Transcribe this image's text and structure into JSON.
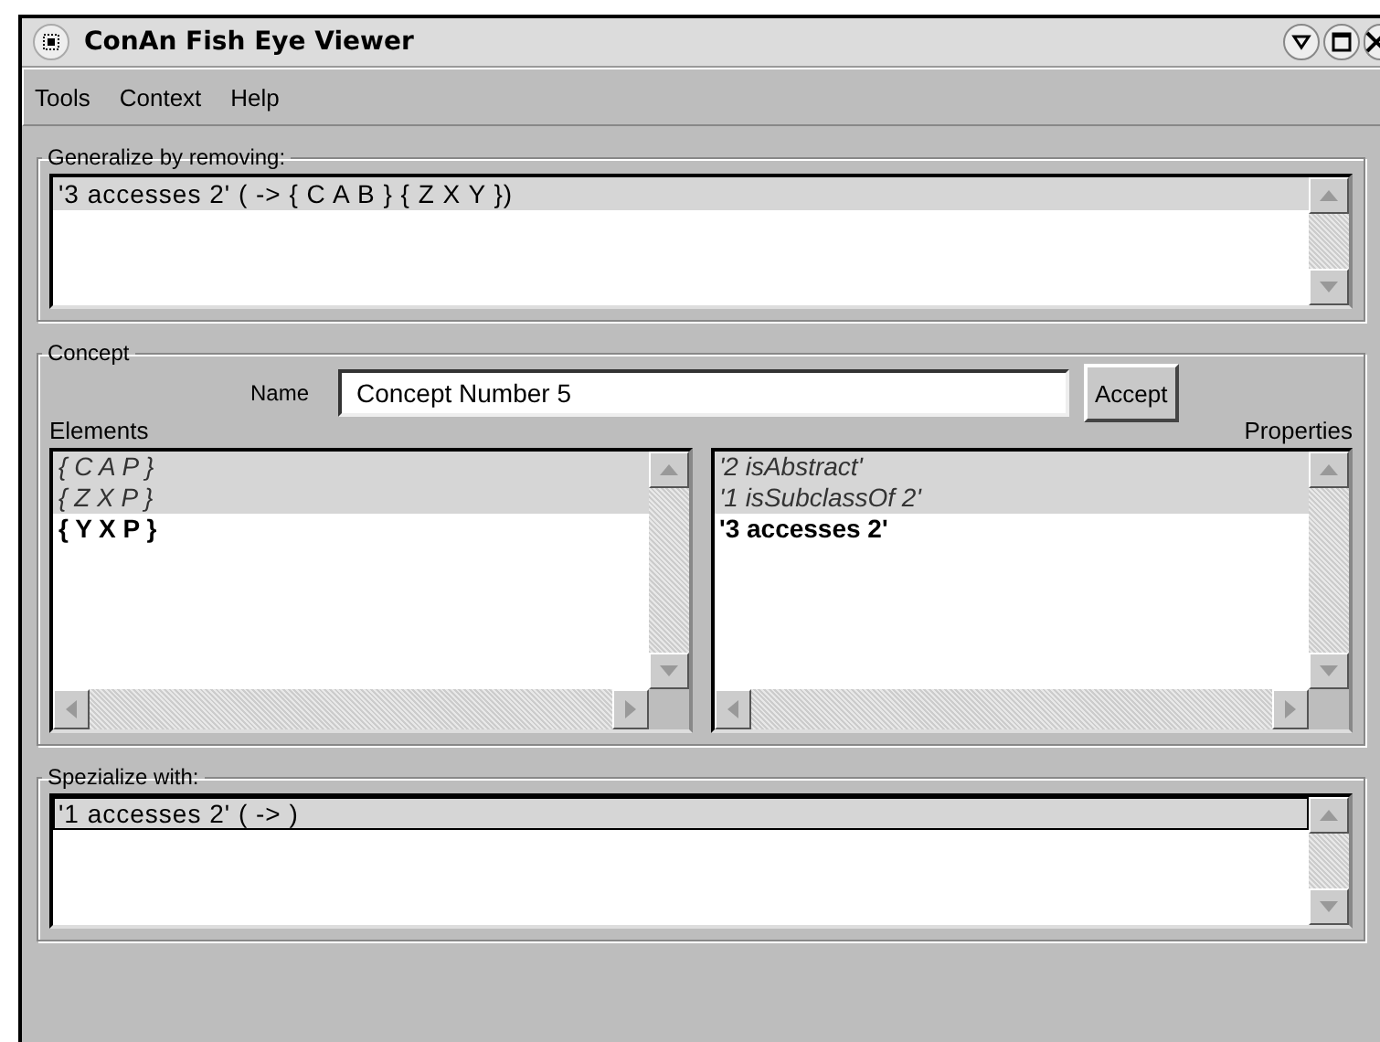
{
  "window": {
    "title": "ConAn Fish Eye Viewer"
  },
  "menu": [
    "Tools",
    "Context",
    "Help"
  ],
  "generalize": {
    "label": "Generalize by removing:",
    "items": [
      {
        "text": "'3 accesses 2' ( -> { C A B } { Z X Y })",
        "selected": true
      }
    ]
  },
  "concept": {
    "label": "Concept",
    "name_label": "Name",
    "name_value": "Concept Number 5",
    "accept": "Accept",
    "elements_label": "Elements",
    "properties_label": "Properties",
    "elements": [
      {
        "text": "{ C A P }",
        "kind": "italic",
        "selected": true
      },
      {
        "text": "{ Z X P }",
        "kind": "italic",
        "selected": true
      },
      {
        "text": "{ Y X P }",
        "kind": "bold",
        "selected": false
      }
    ],
    "properties": [
      {
        "text": "'2 isAbstract'",
        "kind": "italic",
        "selected": true
      },
      {
        "text": "'1 isSubclassOf 2'",
        "kind": "italic",
        "selected": true
      },
      {
        "text": "'3 accesses 2'",
        "kind": "bold",
        "selected": false
      }
    ]
  },
  "specialize": {
    "label": "Spezialize with:",
    "items": [
      {
        "text": "'1 accesses 2' ( -> )",
        "selected": true
      }
    ]
  }
}
